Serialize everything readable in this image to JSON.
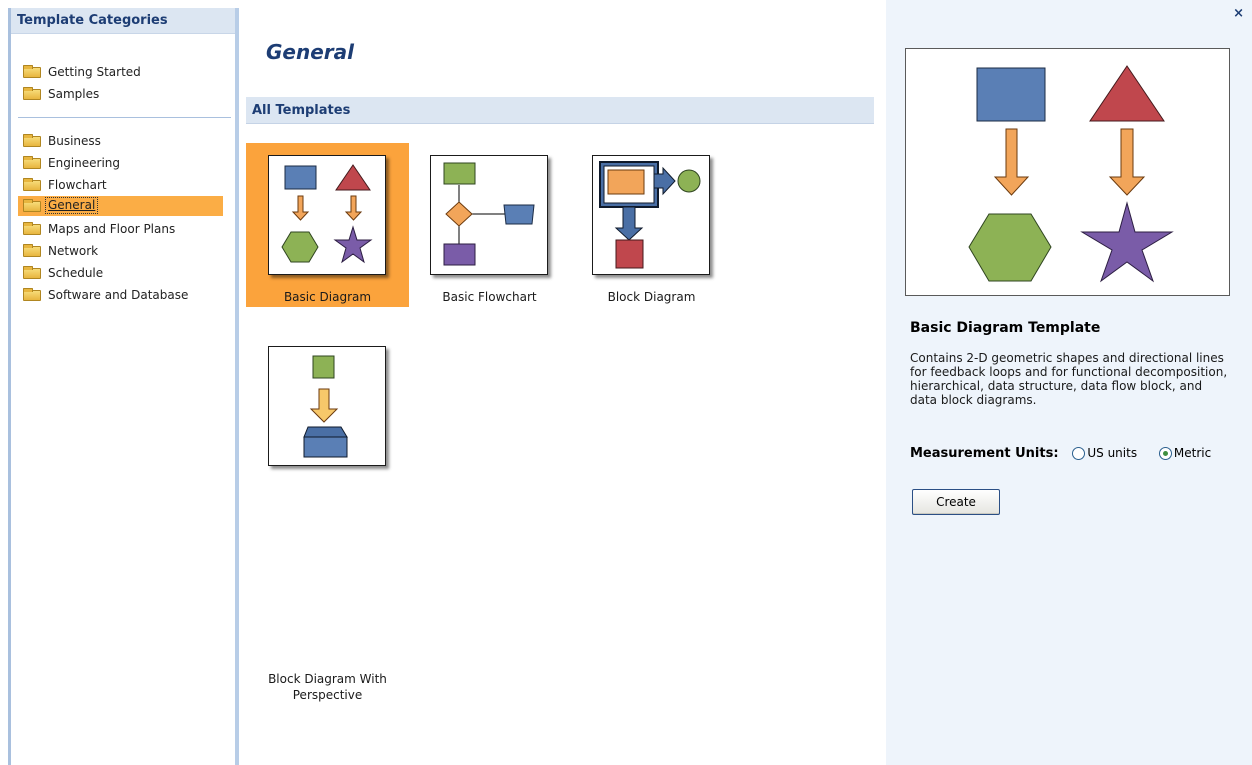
{
  "sidebar": {
    "header": "Template Categories",
    "group1": [
      {
        "label": "Getting Started",
        "icon": "folder-icon"
      },
      {
        "label": "Samples",
        "icon": "folder-icon"
      }
    ],
    "group2": [
      {
        "label": "Business",
        "icon": "folder-icon"
      },
      {
        "label": "Engineering",
        "icon": "folder-icon"
      },
      {
        "label": "Flowchart",
        "icon": "folder-icon"
      },
      {
        "label": "General",
        "icon": "folder-open-icon",
        "selected": true
      },
      {
        "label": "Maps and Floor Plans",
        "icon": "folder-icon"
      },
      {
        "label": "Network",
        "icon": "folder-icon"
      },
      {
        "label": "Schedule",
        "icon": "folder-icon"
      },
      {
        "label": "Software and Database",
        "icon": "folder-icon"
      }
    ]
  },
  "main": {
    "title": "General",
    "section": "All Templates",
    "templates": [
      {
        "label": "Basic Diagram",
        "selected": true
      },
      {
        "label": "Basic Flowchart"
      },
      {
        "label": "Block Diagram"
      },
      {
        "label": "Block Diagram With Perspective"
      }
    ]
  },
  "details": {
    "close": "×",
    "title": "Basic Diagram Template",
    "description": "Contains 2-D geometric shapes and directional lines for feedback loops and for functional decomposition, hierarchical, data structure, data flow block, and data block diagrams.",
    "units_label": "Measurement Units:",
    "units_options": [
      "US units",
      "Metric"
    ],
    "units_selected": "Metric",
    "create_label": "Create"
  },
  "colors": {
    "accent": "#fba33c",
    "header_bg": "#dce6f2",
    "header_text": "#1d3d74",
    "panel_bg": "#eef4fb",
    "shape_blue": "#5a7fb5",
    "shape_red": "#c0474d",
    "shape_orange": "#f2a55a",
    "shape_green": "#8db255",
    "shape_purple": "#7a5ca8"
  }
}
